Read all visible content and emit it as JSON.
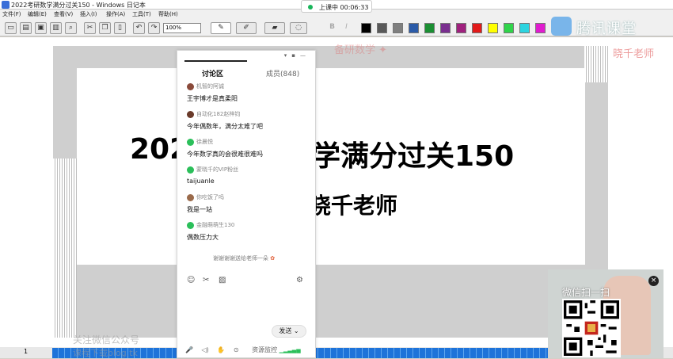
{
  "window": {
    "title": "2022考研数学满分过关150 - Windows 日记本"
  },
  "class_status": {
    "label": "上课中 00:06:33"
  },
  "brand": {
    "name": "腾讯课堂"
  },
  "menu": [
    "文件(F)",
    "编辑(E)",
    "查看(V)",
    "插入(I)",
    "操作(A)",
    "工具(T)",
    "帮助(H)"
  ],
  "toolbar": {
    "zoom": "100%",
    "colors": [
      "#000000",
      "#595959",
      "#7f7f7f",
      "#2b5ba8",
      "#1b8f33",
      "#7a2f8f",
      "#a0217e",
      "#e21a1a",
      "#ffff00",
      "#30d44a",
      "#2cd4e0",
      "#e01ccf",
      "#ffffff"
    ]
  },
  "slide": {
    "title_left": "202",
    "title_right": "学满分过关150",
    "subtitle": "晓千老师",
    "watermark_top": "备研数学 ✦",
    "watermark_right": "晓千老师",
    "watermark_bottom_1": "关注微信公众号",
    "watermark_bottom_2": "课程下载blog.tk"
  },
  "page_number": "1",
  "chat": {
    "tabs": {
      "discuss": "讨论区",
      "members": "成员(848)"
    },
    "messages": [
      {
        "user": "机智的阿诚",
        "text": "王宇博才是真柔阳",
        "avatar_color": "#8a4a3a"
      },
      {
        "user": "自动化182赵梓钧",
        "text": "今年偶数年，满分太难了吧",
        "avatar_color": "#6a3a2a"
      },
      {
        "user": "徐晨悦",
        "text": "今年数学真的会很难很难吗",
        "avatar_color": "#2bbf5a"
      },
      {
        "user": "蒙晓千的VIP粉丝",
        "text": "taijuanle",
        "avatar_color": "#2bbf5a"
      },
      {
        "user": "你吃饭了吗",
        "text": "我是一站",
        "avatar_color": "#9a6a4a"
      },
      {
        "user": "金融萌萌生130",
        "text": "偶数压力大",
        "avatar_color": "#2bbf5a"
      }
    ],
    "gift_line": "谢谢谢谢送给老师一朵",
    "send_label": "发送",
    "bottom_status": "资源监控"
  },
  "qr_panel": {
    "caption": "微信扫一扫"
  }
}
